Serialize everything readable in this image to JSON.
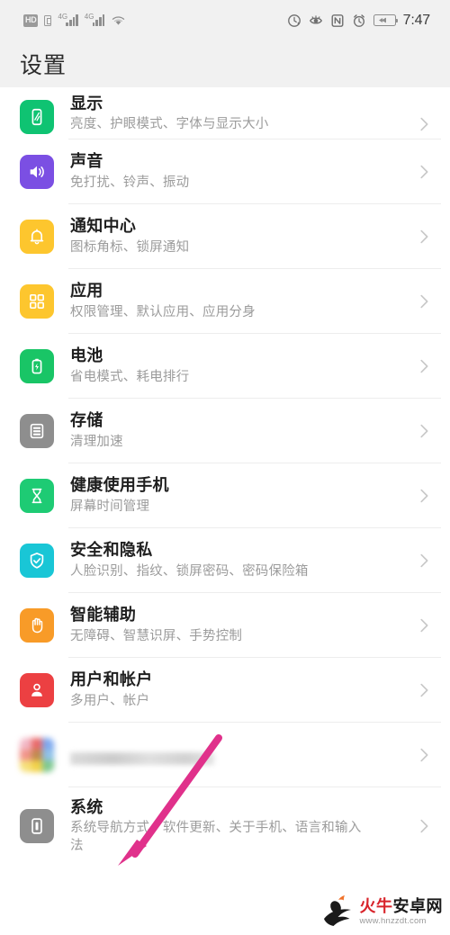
{
  "statusbar": {
    "hd_label": "HD",
    "network_left": "4G",
    "network_right": "4G",
    "time": "7:47",
    "icons_left": [
      "hd-volte-icon",
      "sim-card-icon",
      "signal-4g-icon-1",
      "signal-4g-icon-2",
      "wifi-icon"
    ],
    "icons_right": [
      "data-saver-icon",
      "eye-comfort-icon",
      "nfc-icon",
      "alarm-icon",
      "battery-icon"
    ]
  },
  "header": {
    "title": "设置"
  },
  "list": {
    "items": [
      {
        "title": "显示",
        "subtitle": "亮度、护眼模式、字体与显示大小",
        "icon": "display-icon",
        "color": "#0fc372"
      },
      {
        "title": "声音",
        "subtitle": "免打扰、铃声、振动",
        "icon": "sound-icon",
        "color": "#7b4fe3"
      },
      {
        "title": "通知中心",
        "subtitle": "图标角标、锁屏通知",
        "icon": "notification-bell-icon",
        "color": "#fdc62e"
      },
      {
        "title": "应用",
        "subtitle": "权限管理、默认应用、应用分身",
        "icon": "apps-grid-icon",
        "color": "#fdc62e"
      },
      {
        "title": "电池",
        "subtitle": "省电模式、耗电排行",
        "icon": "battery-charge-icon",
        "color": "#19c566"
      },
      {
        "title": "存储",
        "subtitle": "清理加速",
        "icon": "storage-icon",
        "color": "#8e8e8e"
      },
      {
        "title": "健康使用手机",
        "subtitle": "屏幕时间管理",
        "icon": "hourglass-icon",
        "color": "#1ecb74"
      },
      {
        "title": "安全和隐私",
        "subtitle": "人脸识别、指纹、锁屏密码、密码保险箱",
        "icon": "shield-check-icon",
        "color": "#19c6d6"
      },
      {
        "title": "智能辅助",
        "subtitle": "无障碍、智慧识屏、手势控制",
        "icon": "hand-icon",
        "color": "#f89b28"
      },
      {
        "title": "用户和帐户",
        "subtitle": "多用户、帐户",
        "icon": "user-account-icon",
        "color": "#ec4042"
      },
      {
        "title": "",
        "subtitle": "",
        "icon": "google-services-icon",
        "color": "#cfcfcf",
        "blurred": true
      },
      {
        "title": "系统",
        "subtitle": "系统导航方式、软件更新、关于手机、语言和输入法",
        "icon": "system-info-icon",
        "color": "#8e8e8e"
      }
    ]
  },
  "annotation": {
    "arrow_color": "#e0318b",
    "arrow_name": "pointer-arrow-to-system"
  },
  "watermark": {
    "brand_red": "火牛",
    "brand_black": "安卓网",
    "url": "www.hnzzdt.com"
  },
  "colors": {
    "header_bg": "#f1f1f1",
    "list_bg": "#ffffff",
    "title_text": "#2b2b2b",
    "row_title": "#1f1f1f",
    "row_sub": "#9b9b9b",
    "separator": "#ededed",
    "chevron": "#c8c8c8"
  }
}
